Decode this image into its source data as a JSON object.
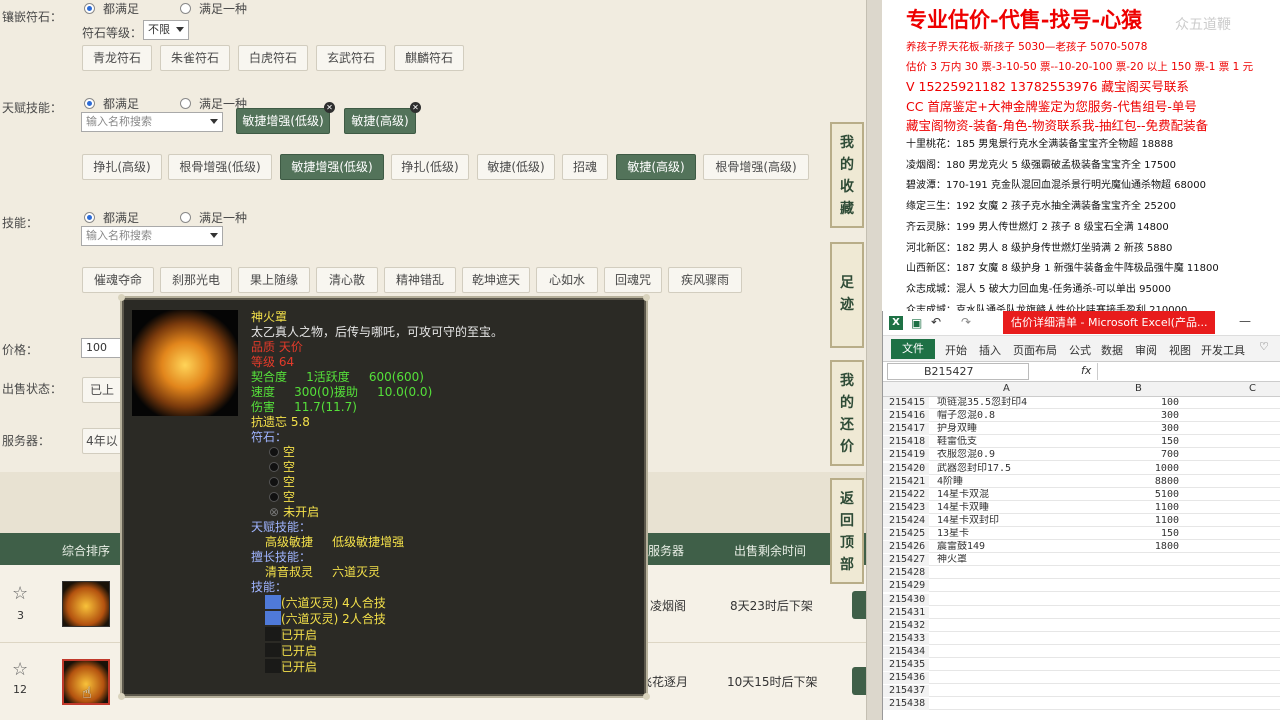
{
  "left": {
    "inlay_label": "镶嵌符石：",
    "inlay_all": "都满足",
    "inlay_one": "满足一种",
    "rune_level_label": "符石等级：",
    "rune_level_value": "不限",
    "rune_buttons": [
      "青龙符石",
      "朱雀符石",
      "白虎符石",
      "玄武符石",
      "麒麟符石"
    ],
    "talent_label": "天赋技能：",
    "talent_all": "都满足",
    "talent_one": "满足一种",
    "talent_search_placeholder": "输入名称搜索",
    "talent_selected": [
      "敏捷增强(低级)",
      "敏捷(高级)"
    ],
    "talent_buttons": [
      "挣扎(高级)",
      "根骨增强(低级)",
      "敏捷增强(低级)",
      "挣扎(低级)",
      "敏捷(低级)",
      "招魂",
      "敏捷(高级)",
      "根骨增强(高级)"
    ],
    "skill_label": "技能：",
    "skill_all": "都满足",
    "skill_one": "满足一种",
    "skill_search_placeholder": "输入名称搜索",
    "skill_buttons": [
      "催魂夺命",
      "刹那光电",
      "果上随缘",
      "清心散",
      "精神错乱",
      "乾坤遮天",
      "心如水",
      "回魂咒",
      "疾风骤雨"
    ],
    "price_label": "价格：",
    "price_value": "100",
    "sale_status_label": "出售状态：",
    "sale_status_value": "已上",
    "server_label": "服务器：",
    "server_value": "4年以",
    "table_header_sort": "综合排序",
    "table_header_server": "服务器",
    "table_header_time": "出售剩余时间",
    "rows": [
      {
        "count": "3",
        "server": "凌烟阁",
        "time": "8天23时后下架"
      },
      {
        "count": "12",
        "server": "飞花逐月",
        "time": "10天15时后下架"
      }
    ],
    "side_buttons": [
      "我的收藏",
      "足迹",
      "我的还价",
      "返回顶部"
    ]
  },
  "popup": {
    "name": "神火罩",
    "desc": "太乙真人之物，后传与哪吒，可攻可守的至宝。",
    "quality": "品质 天价",
    "level": "等级 64",
    "fit": "契合度",
    "fit_val": "1活跃度",
    "fit_val2": "600(600)",
    "speed": "速度",
    "speed_val": "300(0)援助",
    "speed_val2": "10.0(0.0)",
    "damage": "伤害",
    "damage_val": "11.7(11.7)",
    "resist": "抗遗忘 5.8",
    "rune_title": "符石：",
    "runes": [
      "空",
      "空",
      "空",
      "空"
    ],
    "unopened": "未开启",
    "talent_title": "天赋技能：",
    "talents": "高级敏捷     低级敏捷增强",
    "expert_title": "擅长技能：",
    "experts": "清音叔灵     六道灭灵",
    "skill_title": "技能：",
    "skills": [
      "(六道灭灵) 4人合技",
      "(六道灭灵) 2人合技",
      "已开启",
      "已开启",
      "已开启"
    ]
  },
  "right": {
    "title": "专业估价-代售-找号-心猿",
    "watermark": "众五道鞭",
    "lines": [
      "养孩子界天花板-新孩子 5030—老孩子 5070-5078",
      "估价 3 万内 30 票-3-10-50 票--10-20-100 票-20 以上 150 票-1 票 1 元",
      "V 15225921182    13782553976    藏宝阁买号联系",
      "CC 首席鉴定+大神金牌鉴定为您服务-代售组号-单号",
      "藏宝阁物资-装备-角色-物资联系我-抽红包--免费配装备"
    ],
    "list": [
      "十里桃花：185 男鬼景行克水全满装备宝宝齐全物超 18888",
      "凌烟阁：180 男龙克火 5 级强霸破孟极装备宝宝齐全 17500",
      "碧波潭：170-191 克金队混回血混杀景行明光魔仙通杀物超 68000",
      "缘定三生：192 女魔 2 孩子克水抽全满装备宝宝齐全 25200",
      "齐云灵脉：199 男人传世燃灯 2 孩子 8 级宝石全满 14800",
      "河北新区：182 男人 8 级护身传世燃灯坐骑满 2 新孩 5880",
      "山西新区：187 女魔 8 级护身 1 新强牛装备金牛阵极品强牛魔 11800",
      "众志成城：混人 5 破大力回血鬼-任务通杀-可以单出 95000",
      "众志成城：克水队通杀队龙旗赣人性价比哇塞接手盈利 210000"
    ]
  },
  "excel": {
    "title": "估价详细清单 - Microsoft Excel(产品...",
    "ribbon": [
      "文件",
      "开始",
      "插入",
      "页面布局",
      "公式",
      "数据",
      "审阅",
      "视图",
      "开发工具"
    ],
    "namebox": "B215427",
    "fx": "fx",
    "columns": [
      "A",
      "B",
      "C"
    ],
    "rows": [
      {
        "n": "215415",
        "a": "项链混35.5忽封印4",
        "b": "100"
      },
      {
        "n": "215416",
        "a": "帽子忽混0.8",
        "b": "300"
      },
      {
        "n": "215417",
        "a": "护身双睡",
        "b": "300"
      },
      {
        "n": "215418",
        "a": "鞋雷低支",
        "b": "150"
      },
      {
        "n": "215419",
        "a": "衣服忽混0.9",
        "b": "700"
      },
      {
        "n": "215420",
        "a": "武器忽封印17.5",
        "b": "1000"
      },
      {
        "n": "215421",
        "a": "4阶睡",
        "b": "8800"
      },
      {
        "n": "215422",
        "a": "14星卡双混",
        "b": "5100"
      },
      {
        "n": "215423",
        "a": "14星卡双睡",
        "b": "1100"
      },
      {
        "n": "215424",
        "a": "14星卡双封印",
        "b": "1100"
      },
      {
        "n": "215425",
        "a": "13星卡",
        "b": "150"
      },
      {
        "n": "215426",
        "a": "震雷鼓149",
        "b": "1800"
      },
      {
        "n": "215427",
        "a": "神火罩",
        "b": ""
      },
      {
        "n": "215428",
        "a": "",
        "b": ""
      },
      {
        "n": "215429",
        "a": "",
        "b": ""
      },
      {
        "n": "215430",
        "a": "",
        "b": ""
      },
      {
        "n": "215431",
        "a": "",
        "b": ""
      },
      {
        "n": "215432",
        "a": "",
        "b": ""
      },
      {
        "n": "215433",
        "a": "",
        "b": ""
      },
      {
        "n": "215434",
        "a": "",
        "b": ""
      },
      {
        "n": "215435",
        "a": "",
        "b": ""
      },
      {
        "n": "215436",
        "a": "",
        "b": ""
      },
      {
        "n": "215437",
        "a": "",
        "b": ""
      },
      {
        "n": "215438",
        "a": "",
        "b": ""
      }
    ]
  }
}
